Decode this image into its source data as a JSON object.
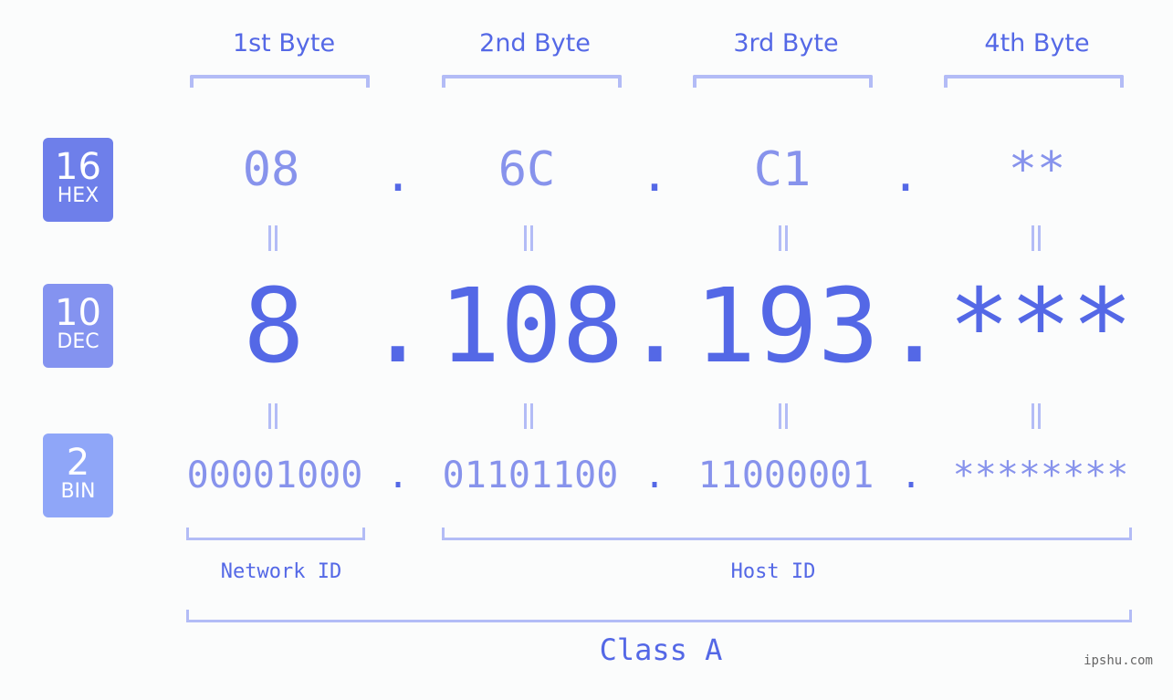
{
  "bytes": [
    {
      "label": "1st Byte",
      "hex": "08",
      "dec": "8",
      "bin": "00001000"
    },
    {
      "label": "2nd Byte",
      "hex": "6C",
      "dec": "108",
      "bin": "01101100"
    },
    {
      "label": "3rd Byte",
      "hex": "C1",
      "dec": "193",
      "bin": "11000001"
    },
    {
      "label": "4th Byte",
      "hex": "**",
      "dec": "***",
      "bin": "********"
    }
  ],
  "separator": ".",
  "badges": {
    "hex": {
      "num": "16",
      "label": "HEX",
      "color": "#6e7fea"
    },
    "dec": {
      "num": "10",
      "label": "DEC",
      "color": "#8493f0"
    },
    "bin": {
      "num": "2",
      "label": "BIN",
      "color": "#8fa6f8"
    }
  },
  "segments": {
    "network": "Network ID",
    "host": "Host ID",
    "class": "Class A"
  },
  "watermark": "ipshu.com",
  "colors": {
    "primary": "#5468e6",
    "secondary": "#8793ec",
    "bracket": "#b3bcf6"
  }
}
